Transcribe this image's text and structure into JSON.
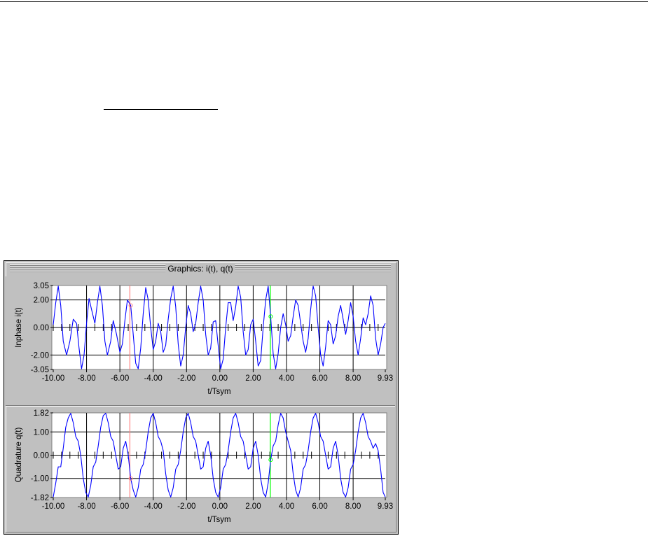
{
  "window": {
    "title": "Graphics: i(t), q(t)"
  },
  "chart_data": [
    {
      "type": "line",
      "title": "",
      "xlabel": "t/Tsym",
      "ylabel": "Inphase i(t)",
      "xlim": [
        -10.0,
        9.93
      ],
      "ylim": [
        -3.05,
        3.05
      ],
      "xticks": [
        "-10.00",
        "-8.00",
        "-6.00",
        "-4.00",
        "-2.00",
        "0.00",
        "2.00",
        "4.00",
        "6.00",
        "8.00",
        "9.93"
      ],
      "yticks": [
        "3.05",
        "2.00",
        "0.00",
        "-2.00",
        "-3.05"
      ],
      "ytick_values": [
        3.05,
        2.0,
        0.0,
        -2.0,
        -3.05
      ],
      "grid": true,
      "series": [
        {
          "color": "#0000ff",
          "points": [
            [
              -10.0,
              0.2
            ],
            [
              -9.85,
              1.8
            ],
            [
              -9.7,
              3.0
            ],
            [
              -9.55,
              1.6
            ],
            [
              -9.4,
              -1.0
            ],
            [
              -9.2,
              -2.0
            ],
            [
              -9.0,
              -1.0
            ],
            [
              -8.8,
              0.6
            ],
            [
              -8.6,
              0.3
            ],
            [
              -8.45,
              -1.5
            ],
            [
              -8.3,
              -3.0
            ],
            [
              -8.15,
              -2.0
            ],
            [
              -8.0,
              0.3
            ],
            [
              -7.85,
              2.1
            ],
            [
              -7.7,
              1.3
            ],
            [
              -7.5,
              0.3
            ],
            [
              -7.35,
              1.8
            ],
            [
              -7.2,
              3.0
            ],
            [
              -7.05,
              1.6
            ],
            [
              -6.9,
              -1.0
            ],
            [
              -6.75,
              -2.0
            ],
            [
              -6.55,
              -1.0
            ],
            [
              -6.4,
              0.5
            ],
            [
              -6.2,
              -0.5
            ],
            [
              -6.0,
              -1.8
            ],
            [
              -5.85,
              -1.2
            ],
            [
              -5.7,
              0.5
            ],
            [
              -5.55,
              2.0
            ],
            [
              -5.35,
              1.6
            ],
            [
              -5.2,
              -0.5
            ],
            [
              -5.05,
              -2.6
            ],
            [
              -4.9,
              -3.0
            ],
            [
              -4.75,
              -1.5
            ],
            [
              -4.6,
              1.0
            ],
            [
              -4.45,
              2.9
            ],
            [
              -4.3,
              2.0
            ],
            [
              -4.15,
              0.0
            ],
            [
              -4.0,
              -1.6
            ],
            [
              -3.85,
              -1.0
            ],
            [
              -3.7,
              0.3
            ],
            [
              -3.55,
              -0.3
            ],
            [
              -3.4,
              -1.8
            ],
            [
              -3.25,
              -1.3
            ],
            [
              -3.1,
              0.6
            ],
            [
              -2.95,
              2.1
            ],
            [
              -2.8,
              3.0
            ],
            [
              -2.65,
              1.5
            ],
            [
              -2.5,
              -1.2
            ],
            [
              -2.35,
              -2.8
            ],
            [
              -2.2,
              -2.0
            ],
            [
              -2.05,
              0.0
            ],
            [
              -1.9,
              1.6
            ],
            [
              -1.75,
              1.0
            ],
            [
              -1.6,
              -0.3
            ],
            [
              -1.45,
              0.3
            ],
            [
              -1.3,
              1.8
            ],
            [
              -1.15,
              3.0
            ],
            [
              -1.0,
              2.0
            ],
            [
              -0.85,
              -0.5
            ],
            [
              -0.7,
              -2.0
            ],
            [
              -0.55,
              -1.5
            ],
            [
              -0.4,
              0.4
            ],
            [
              -0.25,
              0.5
            ],
            [
              -0.1,
              -1.3
            ],
            [
              0.05,
              -3.0
            ],
            [
              0.2,
              -2.3
            ],
            [
              0.35,
              0.0
            ],
            [
              0.5,
              1.8
            ],
            [
              0.65,
              1.8
            ],
            [
              0.8,
              0.5
            ],
            [
              0.95,
              1.5
            ],
            [
              1.1,
              3.0
            ],
            [
              1.25,
              2.2
            ],
            [
              1.4,
              -0.3
            ],
            [
              1.55,
              -2.0
            ],
            [
              1.7,
              -1.6
            ],
            [
              1.85,
              0.2
            ],
            [
              2.0,
              0.6
            ],
            [
              2.15,
              -1.0
            ],
            [
              2.3,
              -2.8
            ],
            [
              2.45,
              -2.4
            ],
            [
              2.6,
              0.0
            ],
            [
              2.75,
              2.0
            ],
            [
              2.9,
              3.0
            ],
            [
              3.05,
              0.8
            ],
            [
              3.2,
              -1.9
            ],
            [
              3.35,
              -3.0
            ],
            [
              3.5,
              -1.9
            ],
            [
              3.65,
              0.0
            ],
            [
              3.8,
              1.0
            ],
            [
              3.95,
              0.2
            ],
            [
              4.1,
              -1.0
            ],
            [
              4.25,
              -0.6
            ],
            [
              4.4,
              0.8
            ],
            [
              4.55,
              2.0
            ],
            [
              4.7,
              1.6
            ],
            [
              4.85,
              0.3
            ],
            [
              5.0,
              -1.0
            ],
            [
              5.15,
              -1.8
            ],
            [
              5.3,
              -0.8
            ],
            [
              5.45,
              1.3
            ],
            [
              5.6,
              3.0
            ],
            [
              5.75,
              2.3
            ],
            [
              5.9,
              0.0
            ],
            [
              6.05,
              -2.0
            ],
            [
              6.2,
              -2.8
            ],
            [
              6.35,
              -1.4
            ],
            [
              6.5,
              0.5
            ],
            [
              6.65,
              0.2
            ],
            [
              6.8,
              -1.2
            ],
            [
              6.95,
              -0.6
            ],
            [
              7.1,
              0.8
            ],
            [
              7.25,
              1.6
            ],
            [
              7.4,
              0.6
            ],
            [
              7.55,
              -0.5
            ],
            [
              7.7,
              0.5
            ],
            [
              7.85,
              1.8
            ],
            [
              8.0,
              0.8
            ],
            [
              8.15,
              -1.0
            ],
            [
              8.3,
              -2.0
            ],
            [
              8.45,
              -0.8
            ],
            [
              8.6,
              0.7
            ],
            [
              8.75,
              0.2
            ],
            [
              8.9,
              1.0
            ],
            [
              9.05,
              2.3
            ],
            [
              9.2,
              1.6
            ],
            [
              9.35,
              -0.8
            ],
            [
              9.5,
              -2.0
            ],
            [
              9.65,
              -1.2
            ],
            [
              9.8,
              0.0
            ],
            [
              9.93,
              0.3
            ]
          ]
        }
      ],
      "markers": [
        {
          "x": -5.4,
          "color": "#ff8080"
        },
        {
          "x": 3.03,
          "color": "#00ff00"
        }
      ]
    },
    {
      "type": "line",
      "title": "",
      "xlabel": "t/Tsym",
      "ylabel": "Quadrature q(t)",
      "xlim": [
        -10.0,
        9.93
      ],
      "ylim": [
        -1.82,
        1.82
      ],
      "xticks": [
        "-10.00",
        "-8.00",
        "-6.00",
        "-4.00",
        "-2.00",
        "0.00",
        "2.00",
        "4.00",
        "6.00",
        "8.00",
        "9.93"
      ],
      "yticks": [
        "1.82",
        "1.00",
        "0.00",
        "-1.00",
        "-1.82"
      ],
      "ytick_values": [
        1.82,
        1.0,
        0.0,
        -1.0,
        -1.82
      ],
      "grid": true,
      "series": [
        {
          "color": "#0000ff",
          "points": [
            [
              -10.0,
              -1.8
            ],
            [
              -9.85,
              -1.2
            ],
            [
              -9.7,
              -0.5
            ],
            [
              -9.55,
              -0.5
            ],
            [
              -9.4,
              0.3
            ],
            [
              -9.25,
              1.2
            ],
            [
              -9.1,
              1.6
            ],
            [
              -8.95,
              1.8
            ],
            [
              -8.8,
              1.4
            ],
            [
              -8.65,
              0.8
            ],
            [
              -8.5,
              0.6
            ],
            [
              -8.35,
              0.0
            ],
            [
              -8.2,
              -1.0
            ],
            [
              -8.05,
              -1.6
            ],
            [
              -7.9,
              -1.8
            ],
            [
              -7.75,
              -1.3
            ],
            [
              -7.6,
              -0.5
            ],
            [
              -7.45,
              -0.3
            ],
            [
              -7.3,
              0.4
            ],
            [
              -7.15,
              1.2
            ],
            [
              -7.0,
              1.7
            ],
            [
              -6.85,
              1.8
            ],
            [
              -6.7,
              1.4
            ],
            [
              -6.55,
              0.8
            ],
            [
              -6.4,
              0.6
            ],
            [
              -6.25,
              0.0
            ],
            [
              -6.1,
              -0.6
            ],
            [
              -5.95,
              -0.5
            ],
            [
              -5.8,
              0.3
            ],
            [
              -5.65,
              0.6
            ],
            [
              -5.5,
              0.0
            ],
            [
              -5.35,
              -1.0
            ],
            [
              -5.2,
              -1.5
            ],
            [
              -5.05,
              -1.8
            ],
            [
              -4.9,
              -1.4
            ],
            [
              -4.75,
              -0.6
            ],
            [
              -4.6,
              -0.4
            ],
            [
              -4.45,
              0.2
            ],
            [
              -4.3,
              1.0
            ],
            [
              -4.15,
              1.6
            ],
            [
              -4.0,
              1.8
            ],
            [
              -3.85,
              1.4
            ],
            [
              -3.7,
              0.8
            ],
            [
              -3.55,
              0.6
            ],
            [
              -3.4,
              0.2
            ],
            [
              -3.25,
              -0.8
            ],
            [
              -3.1,
              -1.5
            ],
            [
              -2.95,
              -1.8
            ],
            [
              -2.8,
              -1.4
            ],
            [
              -2.65,
              -0.6
            ],
            [
              -2.5,
              -0.4
            ],
            [
              -2.35,
              0.2
            ],
            [
              -2.2,
              1.0
            ],
            [
              -2.05,
              1.6
            ],
            [
              -1.9,
              1.8
            ],
            [
              -1.75,
              1.4
            ],
            [
              -1.6,
              0.8
            ],
            [
              -1.45,
              0.6
            ],
            [
              -1.3,
              0.0
            ],
            [
              -1.15,
              -0.6
            ],
            [
              -1.0,
              -0.5
            ],
            [
              -0.85,
              0.3
            ],
            [
              -0.7,
              0.6
            ],
            [
              -0.55,
              0.0
            ],
            [
              -0.4,
              -1.0
            ],
            [
              -0.25,
              -1.6
            ],
            [
              -0.1,
              -1.8
            ],
            [
              0.05,
              -1.4
            ],
            [
              0.2,
              -0.6
            ],
            [
              0.35,
              -0.4
            ],
            [
              0.5,
              0.2
            ],
            [
              0.65,
              1.0
            ],
            [
              0.8,
              1.6
            ],
            [
              0.95,
              1.8
            ],
            [
              1.1,
              1.4
            ],
            [
              1.25,
              0.8
            ],
            [
              1.4,
              0.6
            ],
            [
              1.55,
              0.0
            ],
            [
              1.7,
              -0.6
            ],
            [
              1.85,
              -0.5
            ],
            [
              2.0,
              0.3
            ],
            [
              2.15,
              0.6
            ],
            [
              2.3,
              0.0
            ],
            [
              2.45,
              -1.0
            ],
            [
              2.6,
              -1.6
            ],
            [
              2.75,
              -1.8
            ],
            [
              2.9,
              -1.2
            ],
            [
              3.05,
              -0.2
            ],
            [
              3.2,
              0.4
            ],
            [
              3.35,
              0.6
            ],
            [
              3.5,
              1.3
            ],
            [
              3.65,
              1.8
            ],
            [
              3.8,
              1.6
            ],
            [
              3.95,
              1.0
            ],
            [
              4.1,
              0.6
            ],
            [
              4.25,
              0.2
            ],
            [
              4.4,
              -0.8
            ],
            [
              4.55,
              -1.5
            ],
            [
              4.7,
              -1.8
            ],
            [
              4.85,
              -1.4
            ],
            [
              5.0,
              -0.6
            ],
            [
              5.15,
              -0.4
            ],
            [
              5.3,
              0.2
            ],
            [
              5.45,
              1.0
            ],
            [
              5.6,
              1.6
            ],
            [
              5.75,
              1.8
            ],
            [
              5.9,
              1.4
            ],
            [
              6.05,
              0.8
            ],
            [
              6.2,
              0.6
            ],
            [
              6.35,
              0.0
            ],
            [
              6.5,
              -0.6
            ],
            [
              6.65,
              -0.5
            ],
            [
              6.8,
              0.3
            ],
            [
              6.95,
              0.6
            ],
            [
              7.1,
              0.0
            ],
            [
              7.25,
              -1.0
            ],
            [
              7.4,
              -1.6
            ],
            [
              7.55,
              -1.8
            ],
            [
              7.7,
              -1.4
            ],
            [
              7.85,
              -0.6
            ],
            [
              8.0,
              -0.4
            ],
            [
              8.15,
              0.2
            ],
            [
              8.3,
              1.0
            ],
            [
              8.45,
              1.6
            ],
            [
              8.6,
              1.8
            ],
            [
              8.75,
              1.4
            ],
            [
              8.9,
              0.8
            ],
            [
              9.05,
              0.6
            ],
            [
              9.2,
              0.3
            ],
            [
              9.35,
              0.5
            ],
            [
              9.5,
              0.2
            ],
            [
              9.65,
              -0.6
            ],
            [
              9.8,
              -1.6
            ],
            [
              9.93,
              -1.8
            ]
          ]
        }
      ],
      "markers": [
        {
          "x": -5.4,
          "color": "#ff8080"
        },
        {
          "x": 3.03,
          "color": "#00ff00"
        }
      ]
    }
  ]
}
